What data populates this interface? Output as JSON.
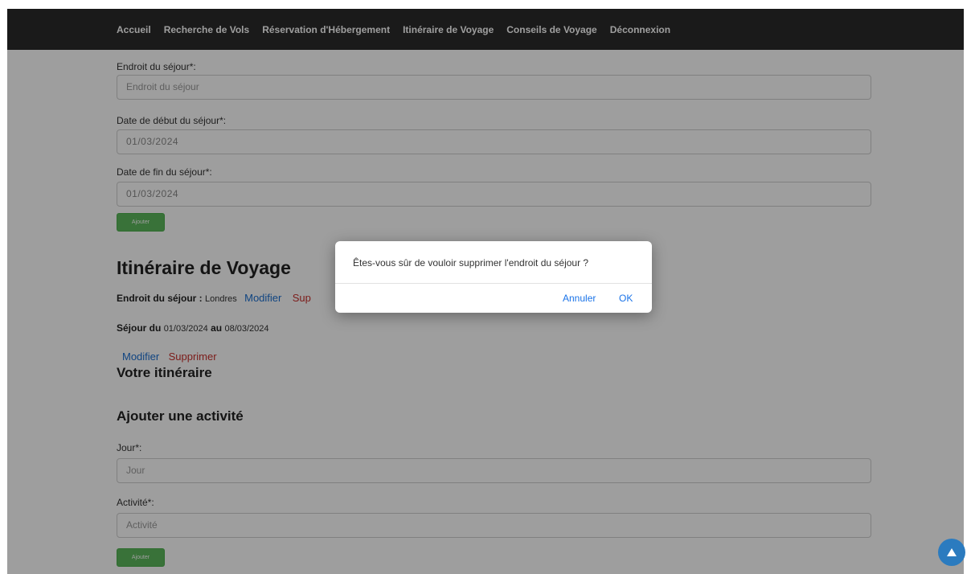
{
  "nav": {
    "items": [
      "Accueil",
      "Recherche de Vols",
      "Réservation d'Hébergement",
      "Itinéraire de Voyage",
      "Conseils de Voyage",
      "Déconnexion"
    ]
  },
  "stay_form": {
    "place_label": "Endroit du séjour*:",
    "place_placeholder": "Endroit du séjour",
    "start_label": "Date de début du séjour*:",
    "start_value": "01/03/2024",
    "end_label": "Date de fin du séjour*:",
    "end_value": "01/03/2024",
    "add_button": "Ajouter"
  },
  "itinerary": {
    "title": "Itinéraire de Voyage",
    "place_label": "Endroit du séjour :",
    "place_value": "Londres",
    "modify_label": "Modifier",
    "delete_label_partial": "Sup",
    "stay_prefix": "Séjour du",
    "stay_start": "01/03/2024",
    "stay_mid": "au",
    "stay_end": "08/03/2024",
    "modify_label2": "Modifier",
    "delete_label2": "Supprimer",
    "your_itinerary": "Votre itinéraire"
  },
  "activity_form": {
    "title": "Ajouter une activité",
    "day_label": "Jour*:",
    "day_placeholder": "Jour",
    "activity_label": "Activité*:",
    "activity_placeholder": "Activité",
    "add_button": "Ajouter"
  },
  "dialog": {
    "message": "Êtes-vous sûr de vouloir supprimer l'endroit du séjour ?",
    "cancel_label": "Annuler",
    "ok_label": "OK"
  },
  "icons": {
    "scroll_top": "arrow-up-icon"
  },
  "colors": {
    "navbar": "#2a2a2a",
    "link_blue": "#1a6fd1",
    "link_red": "#c9302c",
    "button_green": "#5cb85c",
    "scroll_button": "#2b7bbf"
  }
}
